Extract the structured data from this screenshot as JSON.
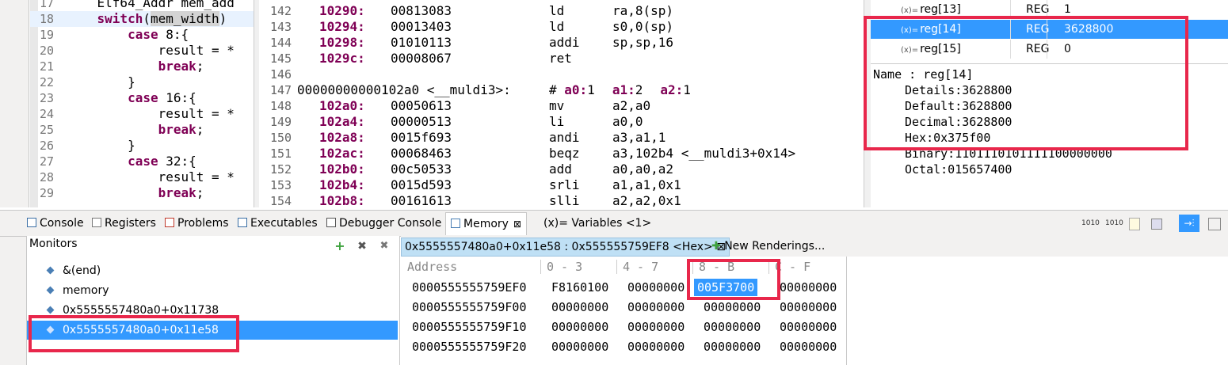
{
  "source": {
    "lines": [
      {
        "num": "17",
        "code": "    Elf64_Addr mem_add"
      },
      {
        "num": "18",
        "code": "    switch(mem_width)"
      },
      {
        "num": "19",
        "code": "        case 8:{"
      },
      {
        "num": "20",
        "code": "            result = *"
      },
      {
        "num": "21",
        "code": "            break;"
      },
      {
        "num": "22",
        "code": "        }"
      },
      {
        "num": "23",
        "code": "        case 16:{"
      },
      {
        "num": "24",
        "code": "            result = *"
      },
      {
        "num": "25",
        "code": "            break;"
      },
      {
        "num": "26",
        "code": "        }"
      },
      {
        "num": "27",
        "code": "        case 32:{"
      },
      {
        "num": "28",
        "code": "            result = *"
      },
      {
        "num": "29",
        "code": "            break;"
      }
    ]
  },
  "disassembly": {
    "lines": [
      {
        "num": "142",
        "addr": "10290:",
        "hex": "00813083",
        "mn": "ld",
        "op": "ra,8(sp)"
      },
      {
        "num": "143",
        "addr": "10294:",
        "hex": "00013403",
        "mn": "ld",
        "op": "s0,0(sp)"
      },
      {
        "num": "144",
        "addr": "10298:",
        "hex": "01010113",
        "mn": "addi",
        "op": "sp,sp,16"
      },
      {
        "num": "145",
        "addr": "1029c:",
        "hex": "00008067",
        "mn": "ret",
        "op": ""
      },
      {
        "num": "146",
        "addr": "",
        "hex": "",
        "mn": "",
        "op": ""
      },
      {
        "num": "147",
        "func": "00000000000102a0 <__muldi3>:",
        "comment_prefix": "# ",
        "regs": [
          {
            "name": "a0:",
            "val": "1"
          },
          {
            "name": "a1:",
            "val": "2"
          },
          {
            "name": "a2:",
            "val": "1"
          }
        ]
      },
      {
        "num": "148",
        "addr": "102a0:",
        "hex": "00050613",
        "mn": "mv",
        "op": "a2,a0"
      },
      {
        "num": "149",
        "addr": "102a4:",
        "hex": "00000513",
        "mn": "li",
        "op": "a0,0"
      },
      {
        "num": "150",
        "addr": "102a8:",
        "hex": "0015f693",
        "mn": "andi",
        "op": "a3,a1,1"
      },
      {
        "num": "151",
        "addr": "102ac:",
        "hex": "00068463",
        "mn": "beqz",
        "op": "a3,102b4 <__muldi3+0x14>"
      },
      {
        "num": "152",
        "addr": "102b0:",
        "hex": "00c50533",
        "mn": "add",
        "op": "a0,a0,a2"
      },
      {
        "num": "153",
        "addr": "102b4:",
        "hex": "0015d593",
        "mn": "srli",
        "op": "a1,a1,0x1"
      },
      {
        "num": "154",
        "addr": "102b8:",
        "hex": "00161613",
        "mn": "slli",
        "op": "a2,a2,0x1"
      }
    ]
  },
  "registers": {
    "icon": "(x)=",
    "rows": [
      {
        "name": "reg[13]",
        "type": "REG",
        "value": "1"
      },
      {
        "name": "reg[14]",
        "type": "REG",
        "value": "3628800",
        "selected": true
      },
      {
        "name": "reg[15]",
        "type": "REG",
        "value": "0"
      }
    ],
    "detail": {
      "name_line": "Name : reg[14]",
      "details": "Details:3628800",
      "default": "Default:3628800",
      "decimal": "Decimal:3628800",
      "hex": "Hex:0x375f00",
      "binary": "Binary:1101110101111100000000",
      "octal": "Octal:015657400"
    }
  },
  "tabs": [
    {
      "label": "Console",
      "icon": "console-icon"
    },
    {
      "label": "Registers",
      "icon": "registers-icon"
    },
    {
      "label": "Problems",
      "icon": "problems-icon"
    },
    {
      "label": "Executables",
      "icon": "executables-icon"
    },
    {
      "label": "Debugger Console",
      "icon": "debugger-console-icon"
    },
    {
      "label": "Memory",
      "icon": "memory-icon",
      "active": true,
      "close": "⊠"
    },
    {
      "label": "(x)= Variables <1>",
      "icon": "variables-icon"
    }
  ],
  "toolbar_icons": [
    "1010",
    "1010"
  ],
  "monitors": {
    "title": "Monitors",
    "add": "+",
    "remove": "✖",
    "remove_all": "✖",
    "items": [
      {
        "label": "&(end)"
      },
      {
        "label": "memory"
      },
      {
        "label": "0x5555557480a0+0x11738"
      },
      {
        "label": "0x5555557480a0+0x11e58",
        "selected": true
      }
    ]
  },
  "memory": {
    "rendering_tab": "0x5555557480a0+0x11e58 : 0x555555759EF8 <Hex>",
    "rendering_close": "⊠",
    "new_renderings": "New Renderings...",
    "headers": [
      "Address",
      "0 - 3",
      "4 - 7",
      "8 - B",
      "C - F"
    ],
    "rows": [
      {
        "addr": "0000555555759EF0",
        "cells": [
          "F8160100",
          "00000000",
          "005F3700",
          "00000000"
        ]
      },
      {
        "addr": "0000555555759F00",
        "cells": [
          "00000000",
          "00000000",
          "00000000",
          "00000000"
        ]
      },
      {
        "addr": "0000555555759F10",
        "cells": [
          "00000000",
          "00000000",
          "00000000",
          "00000000"
        ]
      },
      {
        "addr": "0000555555759F20",
        "cells": [
          "00000000",
          "00000000",
          "00000000",
          "00000000"
        ]
      }
    ]
  },
  "colors": {
    "selection": "#3399ff",
    "annotation_red": "#e8274b",
    "keyword": "#7f0055"
  }
}
